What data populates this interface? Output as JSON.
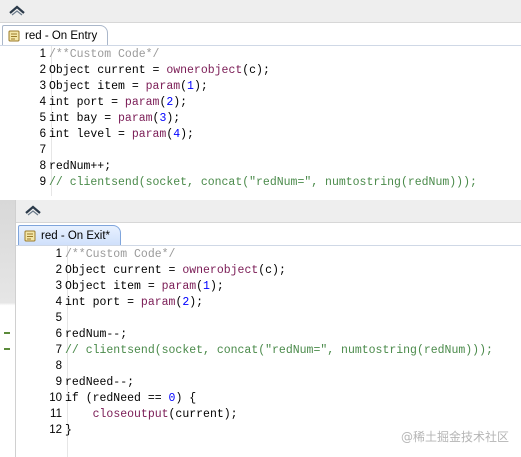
{
  "entry_window": {
    "tab_label": "red - On Entry",
    "icons": {
      "collapse": "collapse-chevron-icon",
      "tab": "script-scroll-icon"
    },
    "lines": [
      {
        "n": "1",
        "tokens": [
          [
            "cm-gray",
            "/**Custom Code*/"
          ]
        ]
      },
      {
        "n": "2",
        "tokens": [
          [
            "plain",
            "Object current = "
          ],
          [
            "func",
            "ownerobject"
          ],
          [
            "plain",
            "(c);"
          ]
        ]
      },
      {
        "n": "3",
        "tokens": [
          [
            "plain",
            "Object item = "
          ],
          [
            "func",
            "param"
          ],
          [
            "plain",
            "("
          ],
          [
            "num",
            "1"
          ],
          [
            "plain",
            ");"
          ]
        ]
      },
      {
        "n": "4",
        "tokens": [
          [
            "plain",
            "int port = "
          ],
          [
            "func",
            "param"
          ],
          [
            "plain",
            "("
          ],
          [
            "num",
            "2"
          ],
          [
            "plain",
            ");"
          ]
        ]
      },
      {
        "n": "5",
        "tokens": [
          [
            "plain",
            "int bay = "
          ],
          [
            "func",
            "param"
          ],
          [
            "plain",
            "("
          ],
          [
            "num",
            "3"
          ],
          [
            "plain",
            ");"
          ]
        ]
      },
      {
        "n": "6",
        "tokens": [
          [
            "plain",
            "int level = "
          ],
          [
            "func",
            "param"
          ],
          [
            "plain",
            "("
          ],
          [
            "num",
            "4"
          ],
          [
            "plain",
            ");"
          ]
        ]
      },
      {
        "n": "7",
        "tokens": []
      },
      {
        "n": "8",
        "tokens": [
          [
            "plain",
            "redNum++;"
          ]
        ]
      },
      {
        "n": "9",
        "tokens": [
          [
            "comment",
            "// clientsend(socket, concat(\"redNum=\", numtostring(redNum)));"
          ]
        ]
      }
    ]
  },
  "exit_window": {
    "tab_label": "red - On Exit*",
    "icons": {
      "collapse": "collapse-chevron-icon",
      "tab": "script-scroll-icon"
    },
    "lines": [
      {
        "n": "1",
        "tokens": [
          [
            "cm-gray",
            "/**Custom Code*/"
          ]
        ]
      },
      {
        "n": "2",
        "tokens": [
          [
            "plain",
            "Object current = "
          ],
          [
            "func",
            "ownerobject"
          ],
          [
            "plain",
            "(c);"
          ]
        ]
      },
      {
        "n": "3",
        "tokens": [
          [
            "plain",
            "Object item = "
          ],
          [
            "func",
            "param"
          ],
          [
            "plain",
            "("
          ],
          [
            "num",
            "1"
          ],
          [
            "plain",
            ");"
          ]
        ]
      },
      {
        "n": "4",
        "tokens": [
          [
            "plain",
            "int port = "
          ],
          [
            "func",
            "param"
          ],
          [
            "plain",
            "("
          ],
          [
            "num",
            "2"
          ],
          [
            "plain",
            ");"
          ]
        ]
      },
      {
        "n": "5",
        "tokens": []
      },
      {
        "n": "6",
        "tokens": [
          [
            "plain",
            "redNum--;"
          ]
        ]
      },
      {
        "n": "7",
        "tokens": [
          [
            "comment",
            "// clientsend(socket, concat(\"redNum=\", numtostring(redNum)));"
          ]
        ]
      },
      {
        "n": "8",
        "tokens": []
      },
      {
        "n": "9",
        "tokens": [
          [
            "plain",
            "redNeed--;"
          ]
        ]
      },
      {
        "n": "10",
        "tokens": [
          [
            "plain",
            "if (redNeed == "
          ],
          [
            "num",
            "0"
          ],
          [
            "plain",
            ") {"
          ]
        ]
      },
      {
        "n": "11",
        "tokens": [
          [
            "plain",
            "    "
          ],
          [
            "func",
            "closeoutput"
          ],
          [
            "plain",
            "(current);"
          ]
        ]
      },
      {
        "n": "12",
        "tokens": [
          [
            "plain",
            "}"
          ]
        ]
      }
    ]
  },
  "watermark": "@稀土掘金技术社区",
  "colors": {
    "function": "#7a1b55",
    "number": "#0000ff",
    "comment": "#4a8a4a",
    "header_comment": "#9a9a9a",
    "active_tab": "#cfe0fb"
  }
}
